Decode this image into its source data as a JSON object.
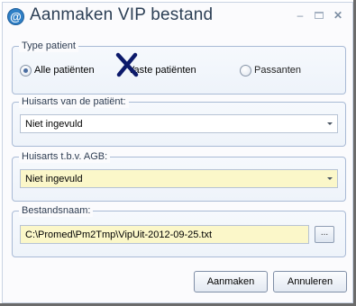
{
  "window": {
    "title": "Aanmaken VIP bestand",
    "icon_glyph": "@",
    "controls": [
      "minimize",
      "maximize",
      "close"
    ]
  },
  "type_patient": {
    "label": "Type patient",
    "options": [
      {
        "label": "Alle patiënten",
        "checked": true
      },
      {
        "label": "Vaste patiënten",
        "checked": false
      },
      {
        "label": "Passanten",
        "checked": false
      }
    ]
  },
  "huisarts": {
    "label": "Huisarts van de patiënt:",
    "value": "Niet ingevuld"
  },
  "huisarts_agb": {
    "label": "Huisarts t.b.v. AGB:",
    "value": "Niet ingevuld"
  },
  "bestandsnaam": {
    "label": "Bestandsnaam:",
    "value": "C:\\Promed\\Pm2Tmp\\VipUit-2012-09-25.txt",
    "browse_label": "..."
  },
  "buttons": {
    "aanmaken": "Aanmaken",
    "annuleren": "Annuleren"
  },
  "colors": {
    "title_text": "#2c3f55",
    "group_border": "#a9bad5",
    "required_field_bg": "#fbf7c9",
    "icon_blue": "#2e7fc6"
  }
}
